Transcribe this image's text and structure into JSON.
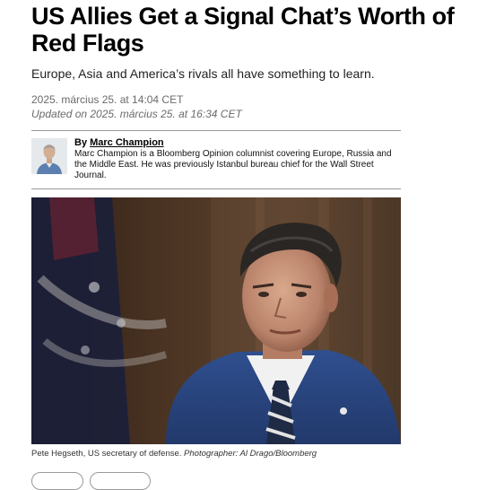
{
  "article": {
    "headline": "US Allies Get a Signal Chat’s Worth of Red Flags",
    "dek": "Europe, Asia and America’s rivals all have something to learn.",
    "published": "2025. március 25. at 14:04 CET",
    "updated": "Updated on 2025. március 25. at 16:34 CET"
  },
  "byline": {
    "prefix": "By",
    "author": "Marc Champion",
    "bio": "Marc Champion is a Bloomberg Opinion columnist covering Europe, Russia and the Middle East. He was previously Istanbul bureau chief for the Wall Street Journal."
  },
  "photo": {
    "caption": "Pete Hegseth, US secretary of defense.",
    "credit": "Photographer: Al Drago/Bloomberg"
  }
}
